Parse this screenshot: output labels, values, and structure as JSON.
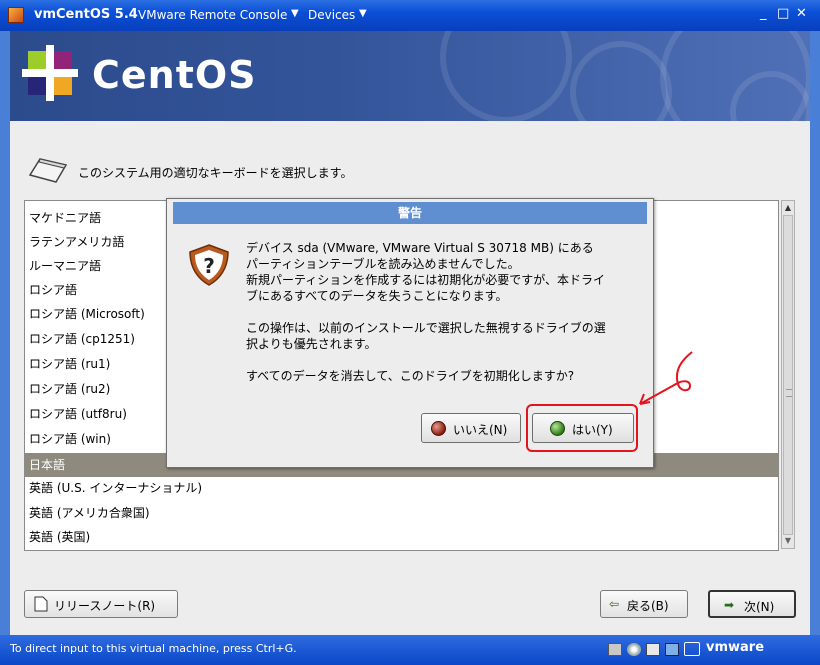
{
  "window": {
    "title": "vmCentOS 5.4",
    "menu_console": "VMware Remote Console",
    "menu_devices": "Devices",
    "minimize": "_",
    "maximize": "□",
    "close": "✕"
  },
  "banner": {
    "brand": "CentOS"
  },
  "page": {
    "instruction": "このシステム用の適切なキーボードを選択します。"
  },
  "keyboard_list": {
    "items": [
      "マケドニア語",
      "ラテンアメリカ語",
      "ルーマニア語",
      "ロシア語",
      "ロシア語 (Microsoft)",
      "ロシア語 (cp1251)",
      "ロシア語 (ru1)",
      "ロシア語 (ru2)",
      "ロシア語 (utf8ru)",
      "ロシア語 (win)",
      "日本語",
      "英語 (U.S. インターナショナル)",
      "英語 (アメリカ合衆国)",
      "英語 (英国)"
    ],
    "selected": "日本語"
  },
  "dialog": {
    "title": "警告",
    "paragraph1": "デバイス sda (VMware, VMware Virtual S 30718 MB) にある\nパーティションテーブルを読み込めませんでした。\n新規パーティションを作成するには初期化が必要ですが、本ドライ\nブにあるすべてのデータを失うことになります。",
    "paragraph2": "この操作は、以前のインストールで選択した無視するドライブの選\n択よりも優先されます。",
    "paragraph3": "すべてのデータを消去して、このドライブを初期化しますか?",
    "no_button": "いいえ(N)",
    "yes_button": "はい(Y)"
  },
  "footer": {
    "release_notes": "リリースノート(R)",
    "back": "戻る(B)",
    "next": "次(N)"
  },
  "statusbar": {
    "message": "To direct input to this virtual machine, press Ctrl+G.",
    "brand": "vmware"
  },
  "colors": {
    "titlebar": "#0a4fd6",
    "dialog_title": "#5f8fd0",
    "selected_row": "#8f8a7e",
    "annotation": "#e3141e"
  }
}
